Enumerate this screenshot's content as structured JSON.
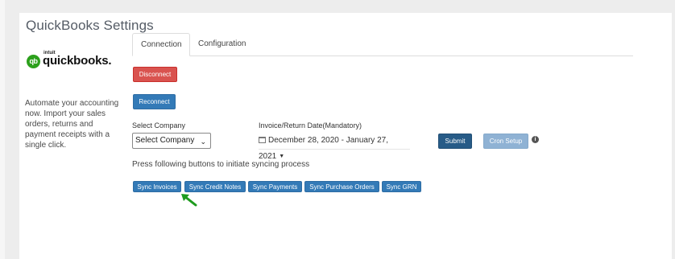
{
  "page": {
    "title": "QuickBooks Settings"
  },
  "logo": {
    "brand_small": "intuit",
    "brand_name": "quickbooks."
  },
  "description": "Automate your accounting now. Import your sales orders, returns and payment receipts with a single click.",
  "tabs": [
    {
      "label": "Connection",
      "active": true
    },
    {
      "label": "Configuration",
      "active": false
    }
  ],
  "buttons": {
    "disconnect": "Disconnect",
    "reconnect": "Reconnect",
    "submit": "Submit",
    "cron_setup": "Cron Setup"
  },
  "company": {
    "label": "Select Company",
    "value": "Select Company",
    "options": [
      "Select Company"
    ]
  },
  "date_range": {
    "label": "Invoice/Return Date(Mandatory)",
    "value": "December 28, 2020 - January 27, 2021"
  },
  "sync": {
    "hint": "Press following buttons to initiate syncing process",
    "buttons": [
      "Sync Invoices",
      "Sync Credit Notes",
      "Sync Payments",
      "Sync Purchase Orders",
      "Sync GRN"
    ]
  },
  "colors": {
    "danger": "#d9534f",
    "primary": "#337ab7",
    "primary_dark": "#275b87",
    "disabled_primary": "#8fb2d4",
    "quickbooks_green": "#2ca01c",
    "arrow_green": "#1e9b1e"
  },
  "icons": {
    "calendar": "calendar-icon",
    "info": "info-icon",
    "select_chevron": "chevron-down-icon",
    "annotation_arrow": "arrow-icon"
  }
}
